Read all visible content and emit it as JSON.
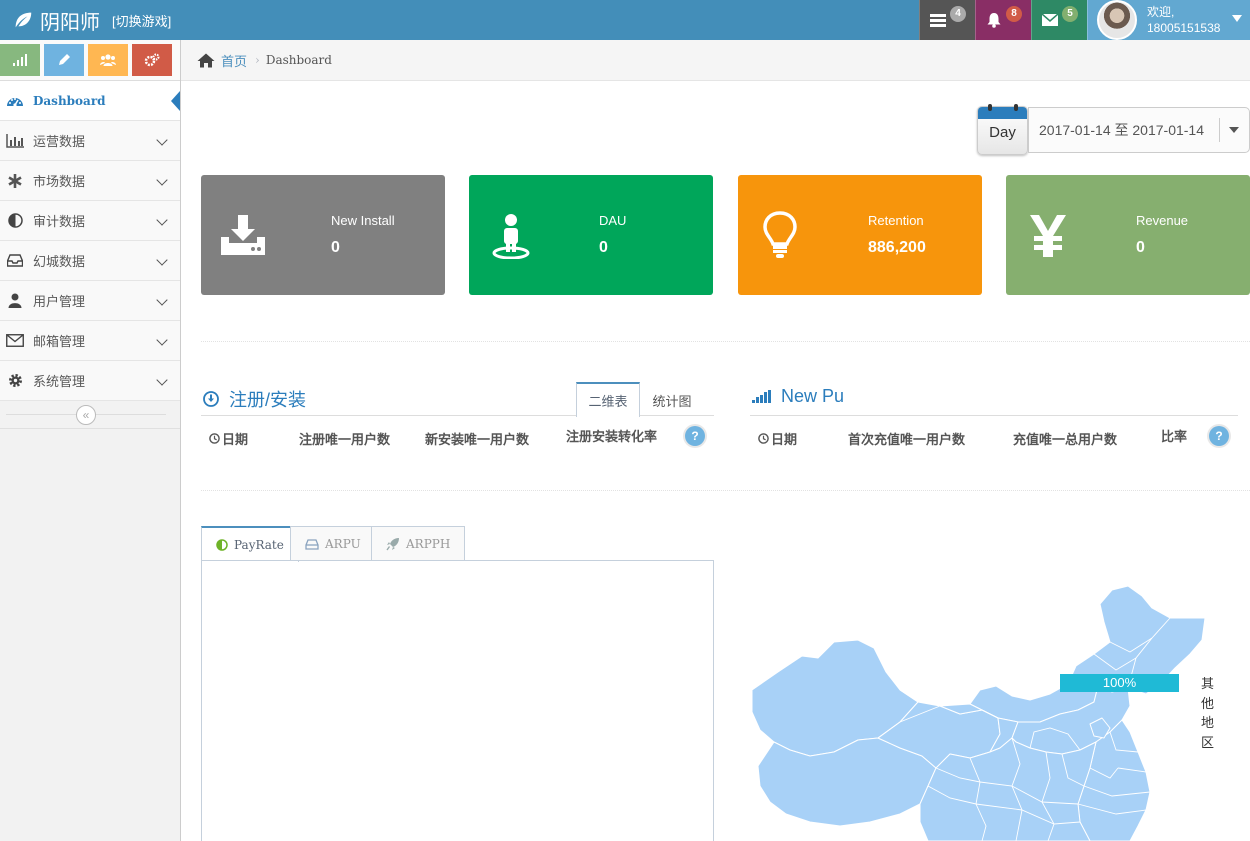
{
  "navbar": {
    "brand": "阴阳师",
    "switch_game": "[切换游戏]",
    "tasks_count": "4",
    "notifications_count": "8",
    "messages_count": "5",
    "welcome": "欢迎,",
    "username": "18005151538",
    "colors": {
      "bar": "#438eb9",
      "tasks": "#555555",
      "notifications": "#892e65",
      "messages": "#2e8965",
      "user": "#62a8d1"
    }
  },
  "sidebar": {
    "shortcut_icons": [
      "signal-icon",
      "pencil-icon",
      "group-icon",
      "cogs-icon"
    ],
    "items": [
      {
        "label": "Dashboard",
        "icon": "dashboard-icon",
        "active": true
      },
      {
        "label": "运营数据",
        "icon": "bar-chart-icon"
      },
      {
        "label": "市场数据",
        "icon": "asterisk-icon"
      },
      {
        "label": "审计数据",
        "icon": "adjust-icon"
      },
      {
        "label": "幻城数据",
        "icon": "inbox-icon"
      },
      {
        "label": "用户管理",
        "icon": "user-icon"
      },
      {
        "label": "邮箱管理",
        "icon": "envelope-icon"
      },
      {
        "label": "系统管理",
        "icon": "gear-icon"
      }
    ]
  },
  "breadcrumb": {
    "home": "首页",
    "current": "Dashboard"
  },
  "date_picker": {
    "mode": "Day",
    "range": "2017-01-14 至 2017-01-14"
  },
  "stats": [
    {
      "label": "New Install",
      "value": "0",
      "color": "#808080",
      "icon": "download-icon"
    },
    {
      "label": "DAU",
      "value": "0",
      "color": "#00a65a",
      "icon": "street-view-icon"
    },
    {
      "label": "Retention",
      "value": "886,200",
      "color": "#f7950c",
      "icon": "lightbulb-icon"
    },
    {
      "label": "Revenue",
      "value": "0",
      "color": "#86af6f",
      "icon": "yen-icon"
    }
  ],
  "register_widget": {
    "title": "注册/安装",
    "tabs": [
      "二维表",
      "统计图"
    ],
    "columns": [
      "日期",
      "注册唯一用户数",
      "新安装唯一用户数",
      "注册安装转化率"
    ],
    "help": "?"
  },
  "newpu_widget": {
    "title": "New Pu",
    "columns": [
      "日期",
      "首次充值唯一用户数",
      "充值唯一总用户数",
      "比率"
    ],
    "help": "?"
  },
  "bottom_tabs": [
    {
      "label": "PayRate",
      "icon": "adjust-icon",
      "active": true
    },
    {
      "label": "ARPU",
      "icon": "hdd-icon"
    },
    {
      "label": "ARPPH",
      "icon": "rocket-icon"
    }
  ],
  "map": {
    "bar_label": "100%",
    "bar_value": 1.0,
    "other_region": "其他地区",
    "fill": "#a8d1f7"
  }
}
